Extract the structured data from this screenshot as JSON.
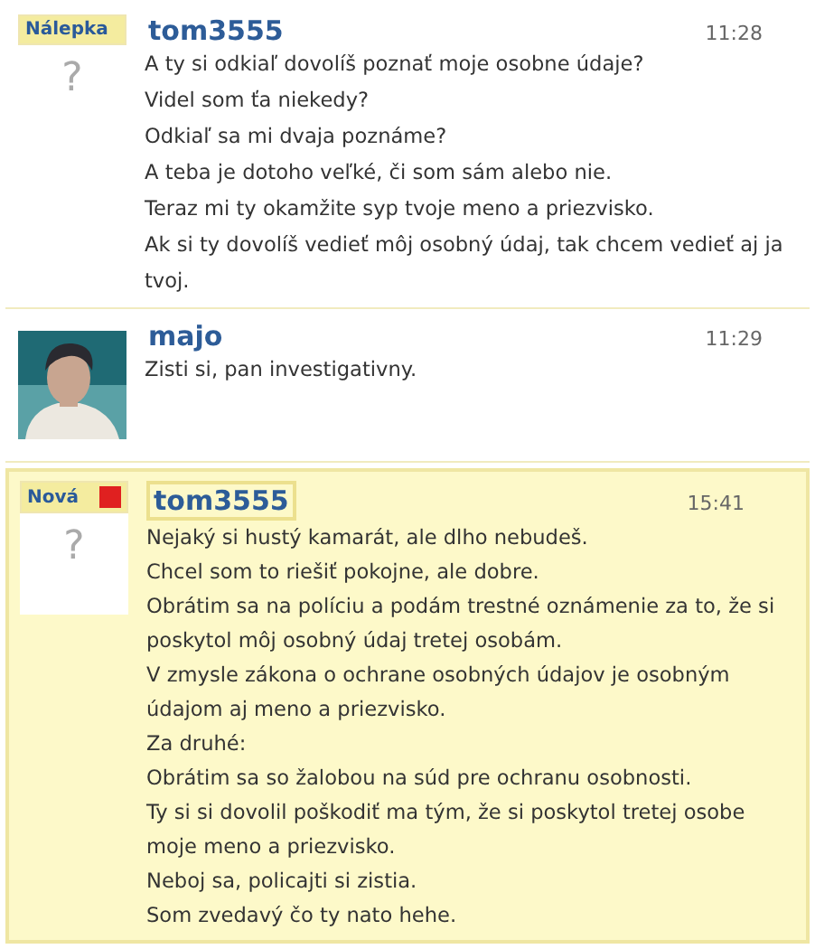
{
  "messages": [
    {
      "badge": {
        "label": "Nálepka",
        "kind": "sticker"
      },
      "avatar": {
        "kind": "placeholder",
        "glyph": "?"
      },
      "author": "tom3555",
      "time": "11:28",
      "highlighted": false,
      "lines": [
        "A ty si odkiaľ dovolíš poznať moje osobne údaje?",
        "Videl som ťa niekedy?",
        "Odkiaľ sa mi dvaja poznáme?",
        "A teba je dotoho veľké, či som sám alebo nie.",
        "Teraz mi ty okamžite syp tvoje meno a priezvisko.",
        "Ak si ty dovolíš vedieť môj osobný údaj, tak chcem vedieť aj ja tvoj."
      ]
    },
    {
      "author": "majo",
      "time": "11:29",
      "highlighted": false,
      "lines": [
        "Zisti si, pan investigativny."
      ]
    },
    {
      "badge": {
        "label": "Nová",
        "kind": "new"
      },
      "avatar": {
        "kind": "placeholder",
        "glyph": "?"
      },
      "author": "tom3555",
      "time": "15:41",
      "highlighted": true,
      "lines": [
        "Nejaký si hustý kamarát, ale dlho nebudeš.",
        "Chcel som to riešiť pokojne, ale dobre.",
        "Obrátim sa na políciu a podám trestné oznámenie za to, že si poskytol môj osobný údaj tretej osobám.",
        "V zmysle zákona o ochrane osobných údajov je osobným údajom aj meno a priezvisko.",
        "Za druhé:",
        "Obrátim sa so žalobou na súd pre ochranu osobnosti.",
        "Ty si si dovolil poškodiť ma tým, že si poskytol tretej osobe moje meno a priezvisko.",
        "Neboj sa, policajti si zistia.",
        "Som zvedavý čo ty nato hehe."
      ]
    }
  ]
}
